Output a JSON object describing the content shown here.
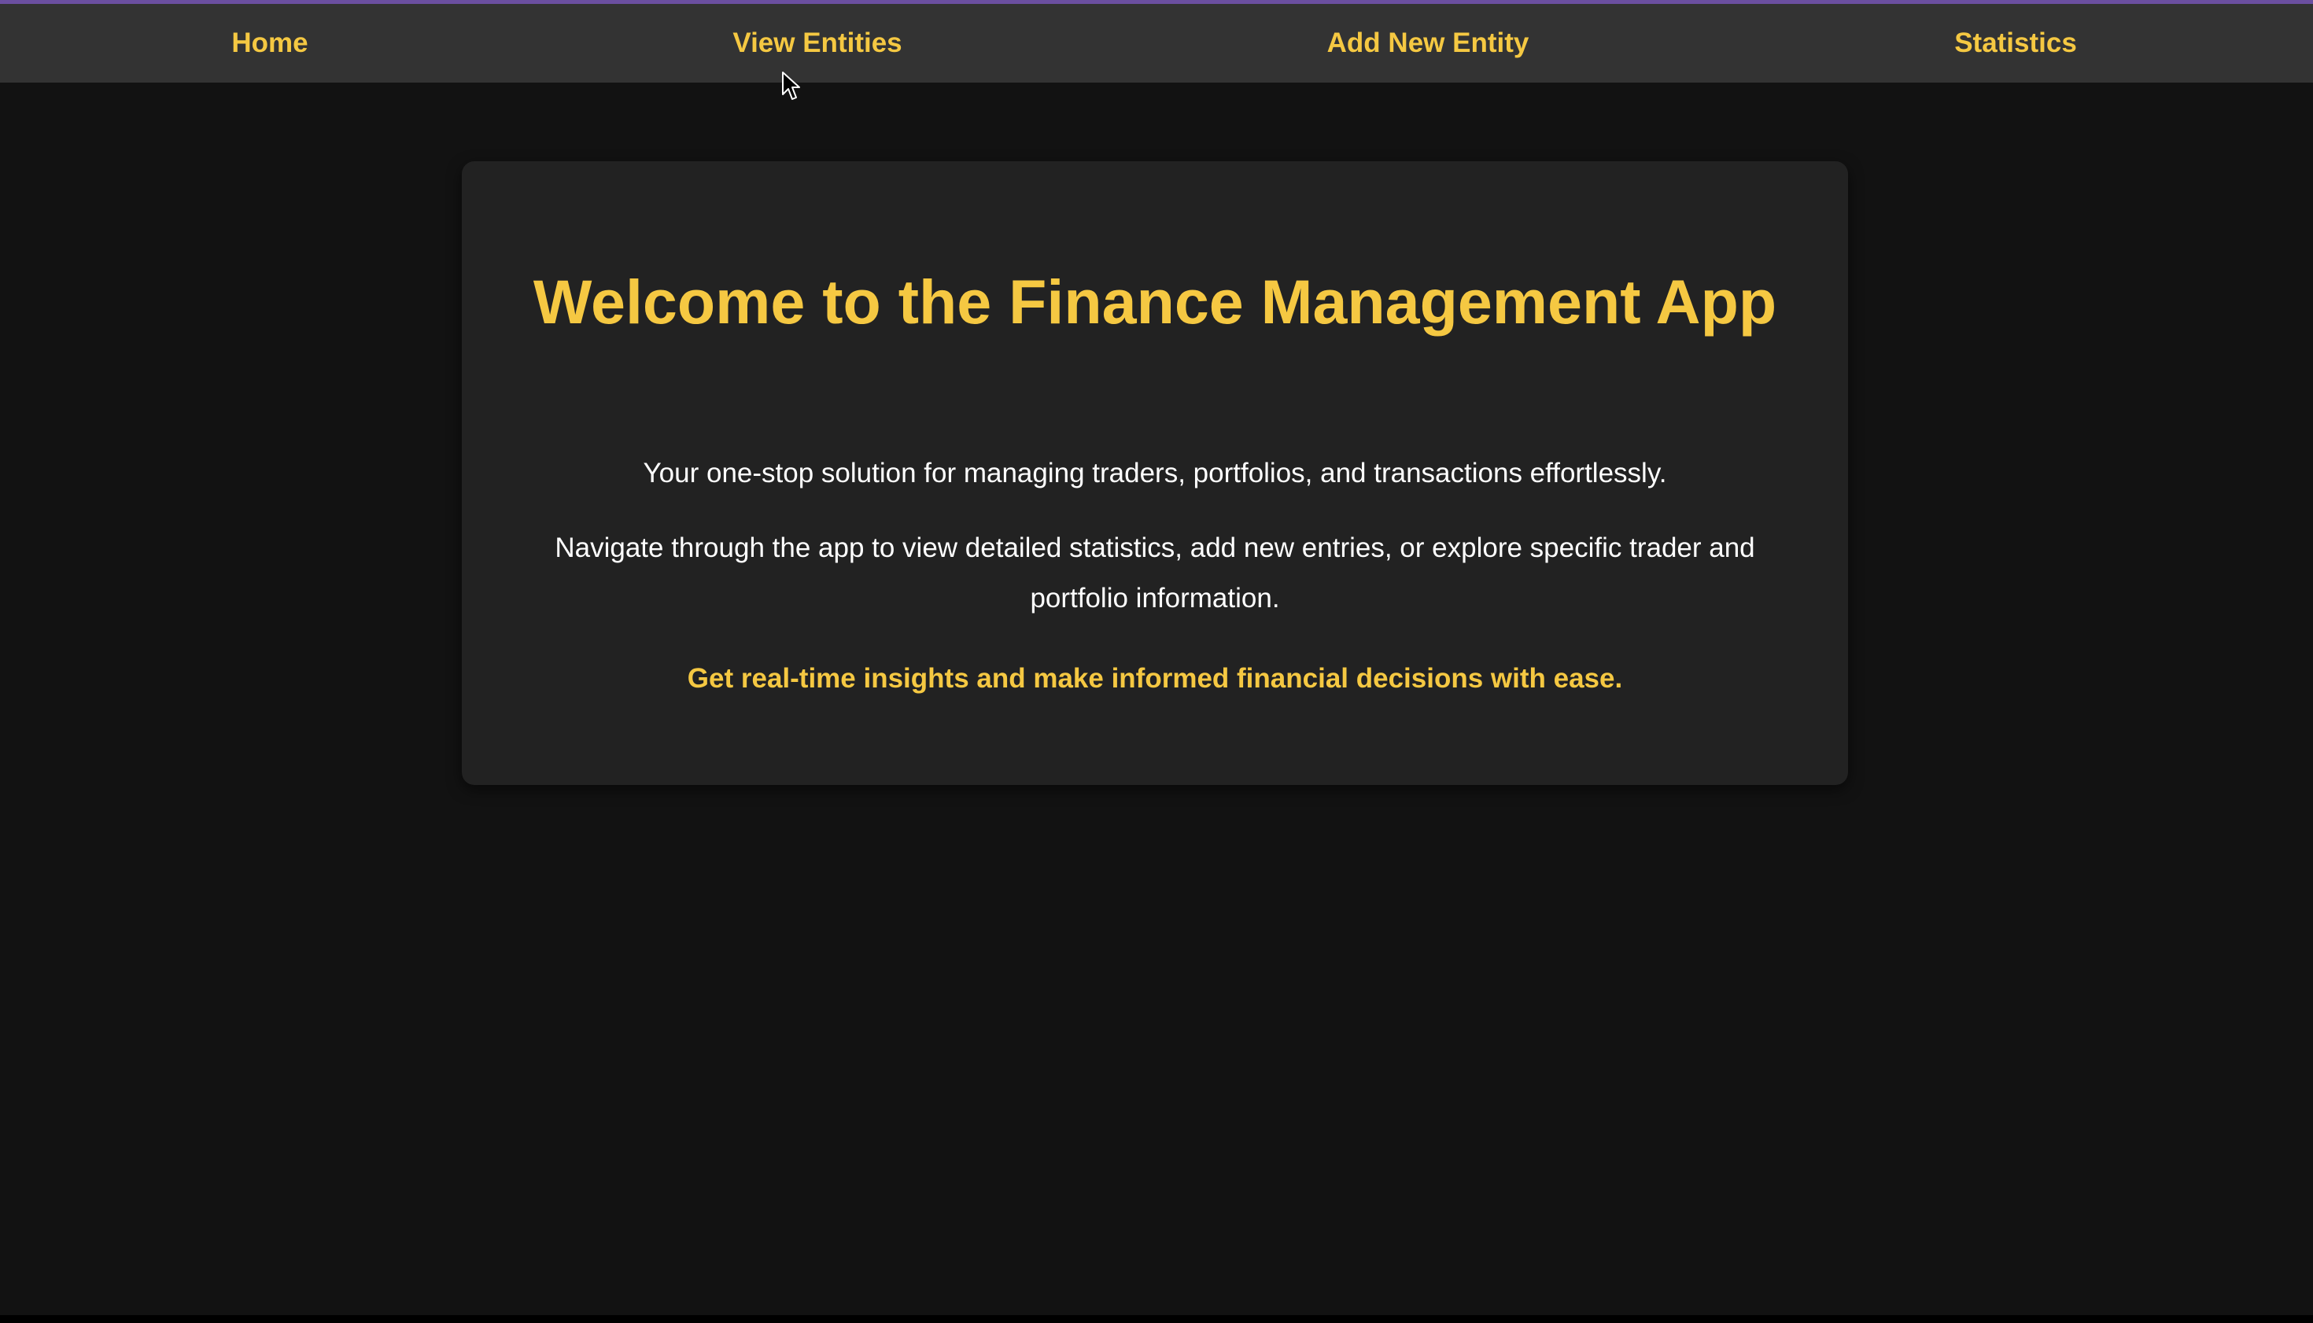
{
  "nav": {
    "items": [
      {
        "label": "Home"
      },
      {
        "label": "View Entities"
      },
      {
        "label": "Add New Entity"
      },
      {
        "label": "Statistics"
      }
    ]
  },
  "hero": {
    "title": "Welcome to the Finance Management App",
    "subtitle": "Your one-stop solution for managing traders, portfolios, and transactions effortlessly.",
    "description": "Navigate through the app to view detailed statistics, add new entries, or explore specific trader and portfolio information.",
    "tagline": "Get real-time insights and make informed financial decisions with ease."
  },
  "colors": {
    "accent": "#f5c842",
    "background": "#121212",
    "navbar": "#333333",
    "card": "#222222",
    "top_border": "#6b4fa0"
  },
  "icons": {
    "cursor": "mouse-pointer-icon"
  }
}
